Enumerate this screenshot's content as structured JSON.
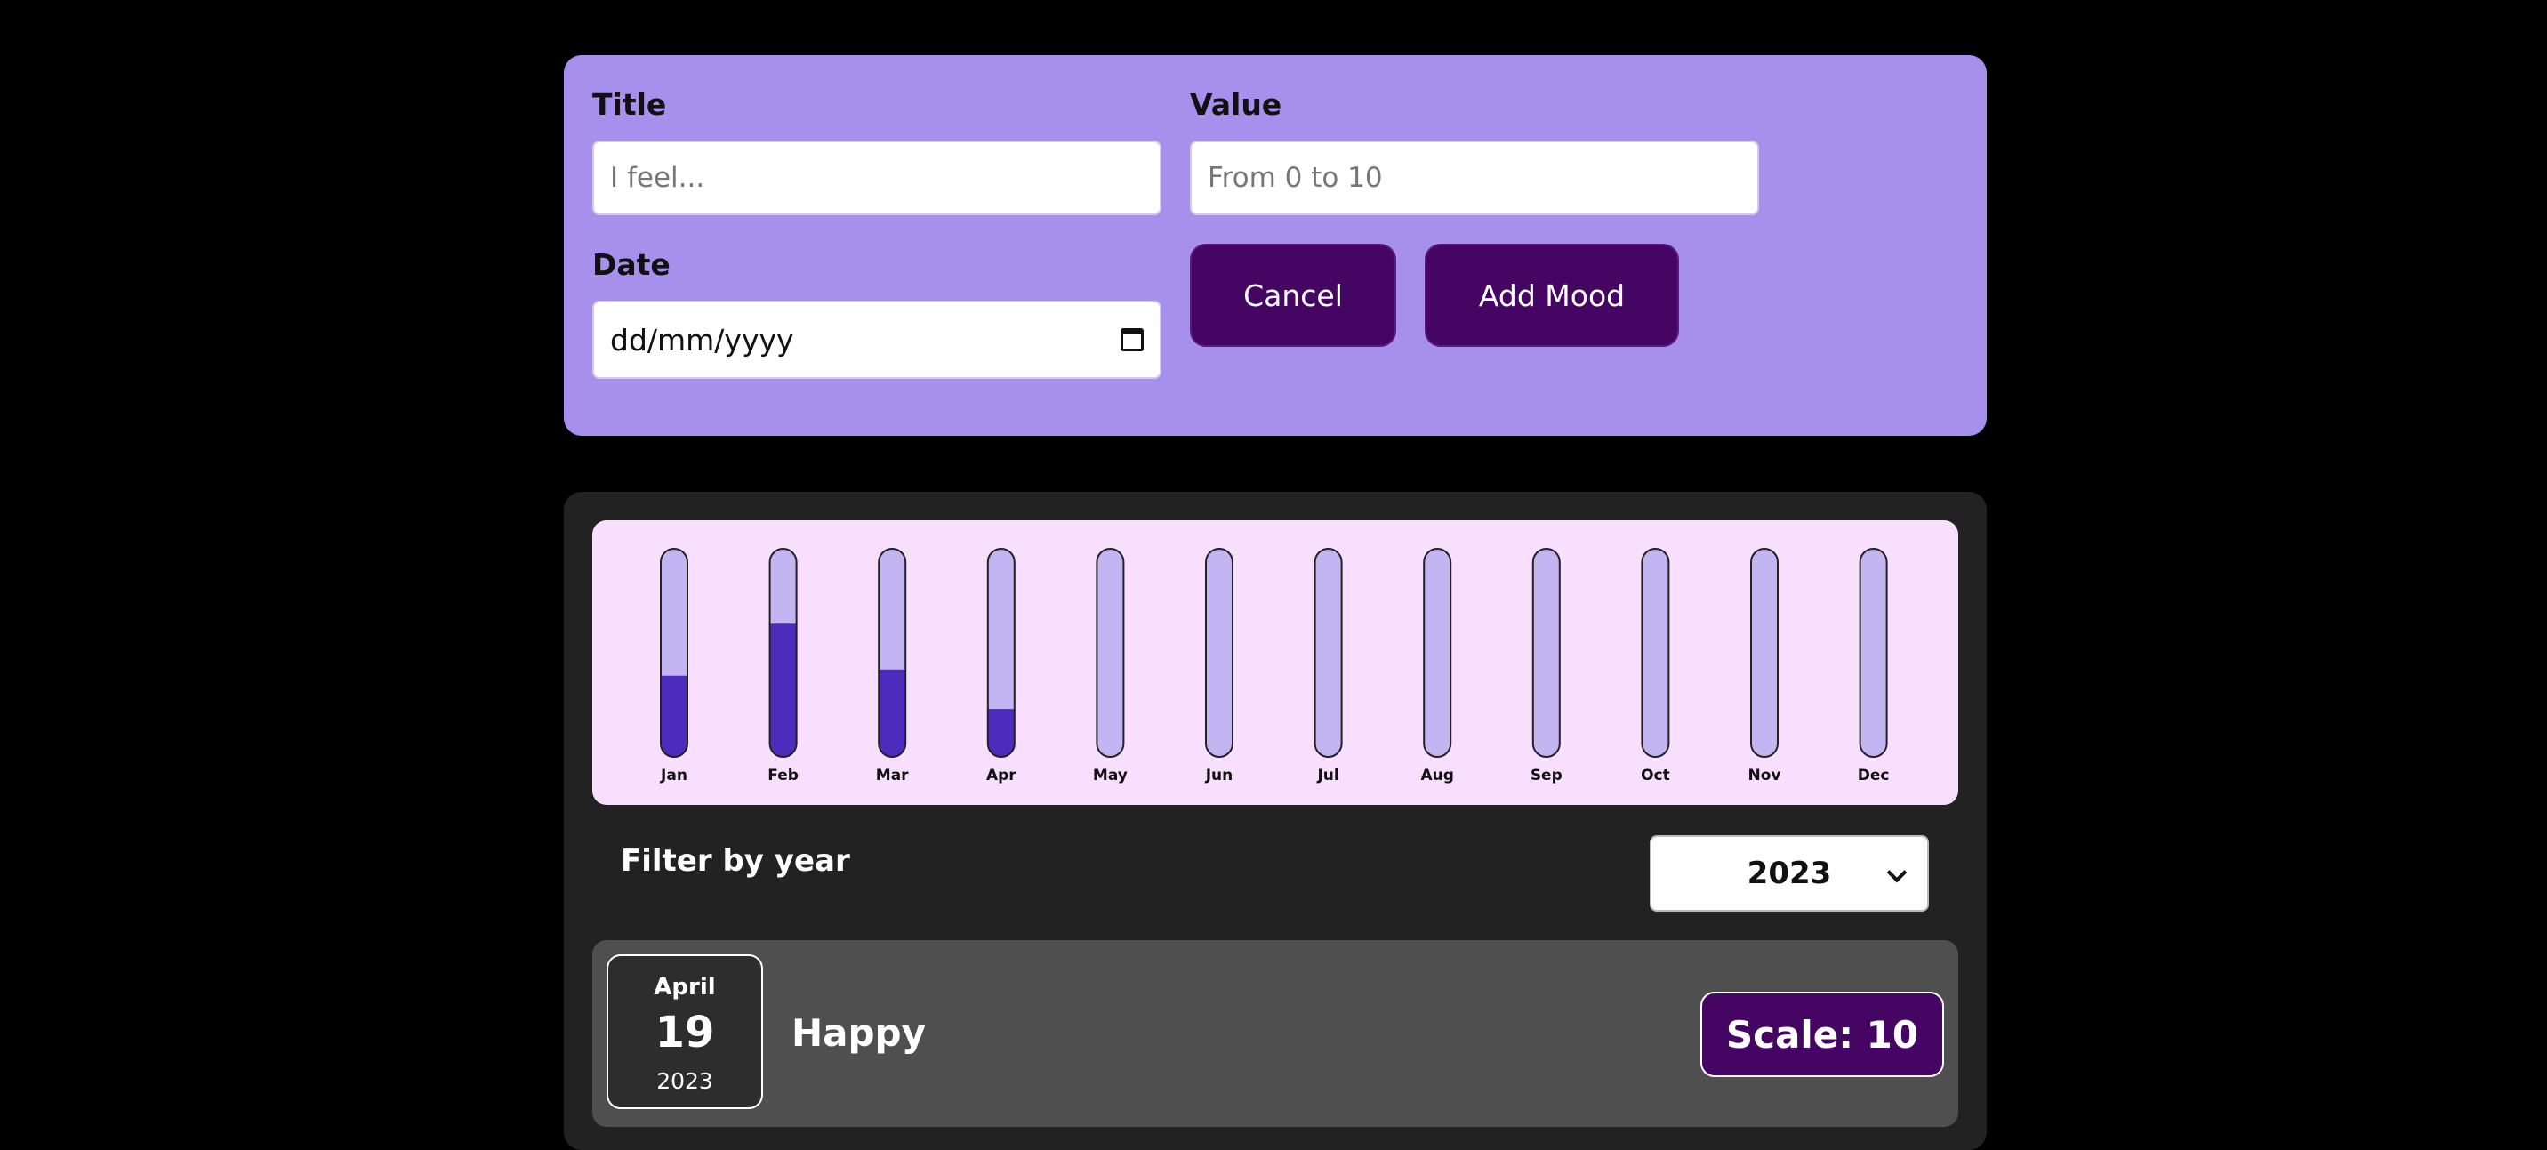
{
  "form": {
    "title_label": "Title",
    "title_placeholder": "I feel...",
    "value_label": "Value",
    "value_placeholder": "From 0 to 10",
    "date_label": "Date",
    "date_placeholder": "dd/mm/yyyy",
    "cancel_label": "Cancel",
    "add_label": "Add Mood"
  },
  "chart_data": {
    "type": "bar",
    "categories": [
      "Jan",
      "Feb",
      "Mar",
      "Apr",
      "May",
      "Jun",
      "Jul",
      "Aug",
      "Sep",
      "Oct",
      "Nov",
      "Dec"
    ],
    "values": [
      3.9,
      6.4,
      4.2,
      2.3,
      0,
      0,
      0,
      0,
      0,
      0,
      0,
      0
    ],
    "ylim": [
      0,
      10
    ],
    "colors": {
      "fill": "#4c2bbd",
      "track": "#c3b4f2",
      "stroke": "#222222",
      "background": "#f7dffd"
    }
  },
  "filter": {
    "label": "Filter by year",
    "selected": "2023"
  },
  "entries": [
    {
      "month": "April",
      "day": "19",
      "year": "2023",
      "title": "Happy",
      "scale": "Scale: 10"
    }
  ],
  "colors": {
    "accent": "#440563",
    "form_bg": "#a690ec",
    "panel_bg": "#222222",
    "entry_bg": "#4f4f4f"
  }
}
